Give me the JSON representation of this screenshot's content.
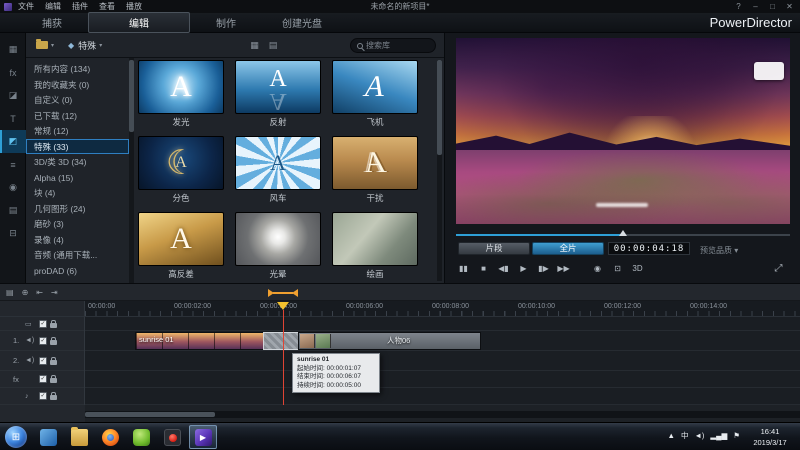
{
  "menubar": {
    "menus": [
      "文件",
      "编辑",
      "插件",
      "查看",
      "播放"
    ],
    "title": "未命名的新项目*",
    "window_controls": {
      "help": "?",
      "minimize": "–",
      "maximize": "□",
      "close": "✕"
    }
  },
  "modebar": {
    "tabs": [
      {
        "id": "capture",
        "label": "捕获",
        "active": false
      },
      {
        "id": "edit",
        "label": "编辑",
        "active": true
      },
      {
        "id": "produce",
        "label": "制作",
        "active": false
      },
      {
        "id": "create-disc",
        "label": "创建光盘",
        "active": false
      }
    ],
    "brand": "PowerDirector"
  },
  "rail": {
    "rooms": [
      {
        "name": "media-room",
        "glyph": "▦",
        "active": false
      },
      {
        "name": "effect-room",
        "glyph": "fx",
        "active": false
      },
      {
        "name": "pip-room",
        "glyph": "◪",
        "active": false
      },
      {
        "name": "title-room",
        "glyph": "T",
        "active": false
      },
      {
        "name": "transition-room",
        "glyph": "◩",
        "active": true
      },
      {
        "name": "audio-mixing-room",
        "glyph": "≡",
        "active": false
      },
      {
        "name": "voice-over-room",
        "glyph": "◉",
        "active": false
      },
      {
        "name": "chapter-room",
        "glyph": "▤",
        "active": false
      },
      {
        "name": "subtitle-room",
        "glyph": "⊟",
        "active": false
      }
    ]
  },
  "library": {
    "toolbar": {
      "filter_icon": "◆",
      "filter_label": "特殊",
      "search_placeholder": "搜索库",
      "view_icons": [
        {
          "name": "grid-view-icon",
          "glyph": "▦"
        },
        {
          "name": "list-view-icon",
          "glyph": "▤"
        }
      ]
    },
    "categories": [
      {
        "label": "所有内容 (134)",
        "selected": false
      },
      {
        "label": "我的收藏夹 (0)",
        "selected": false
      },
      {
        "label": "自定义 (0)",
        "selected": false
      },
      {
        "label": "已下载 (12)",
        "selected": false
      },
      {
        "label": "常规 (12)",
        "selected": false
      },
      {
        "label": "特殊 (33)",
        "selected": true
      },
      {
        "label": "3D/类 3D (34)",
        "selected": false
      },
      {
        "label": "Alpha (15)",
        "selected": false
      },
      {
        "label": "块 (4)",
        "selected": false
      },
      {
        "label": "几何图形 (24)",
        "selected": false
      },
      {
        "label": "磨砂 (3)",
        "selected": false
      },
      {
        "label": "录像 (4)",
        "selected": false
      },
      {
        "label": "音频 (通用下载...",
        "selected": false
      },
      {
        "label": "proDAD (6)",
        "selected": false
      }
    ],
    "transitions": [
      {
        "label": "发光",
        "variant": "glow"
      },
      {
        "label": "反射",
        "variant": "reflect"
      },
      {
        "label": "飞机",
        "variant": "plane"
      },
      {
        "label": "分色",
        "variant": "split"
      },
      {
        "label": "风车",
        "variant": "pinwheel"
      },
      {
        "label": "干扰",
        "variant": "noise"
      },
      {
        "label": "高反差",
        "variant": "contrast"
      },
      {
        "label": "光晕",
        "variant": "halo"
      },
      {
        "label": "绘画",
        "variant": "paint"
      }
    ]
  },
  "preview": {
    "clip_button": "片段",
    "movie_button": "全片",
    "timecode": "00:00:04:18",
    "quality_label": "预览品质 ▾",
    "transport": [
      {
        "name": "pause-button",
        "glyph": "▮▮"
      },
      {
        "name": "stop-button",
        "glyph": "■"
      },
      {
        "name": "step-back-button",
        "glyph": "◀▮"
      },
      {
        "name": "play-button",
        "glyph": "▶"
      },
      {
        "name": "step-forward-button",
        "glyph": "▮▶"
      },
      {
        "name": "fast-forward-button",
        "glyph": "▶▶"
      },
      {
        "name": "snapshot-button",
        "glyph": "◉"
      },
      {
        "name": "preview-window-button",
        "glyph": "⊡"
      },
      {
        "name": "3d-mode-button",
        "glyph": "3D"
      },
      {
        "name": "fullscreen-button",
        "glyph": "⤢"
      }
    ]
  },
  "timeline": {
    "toolbar_icons": [
      {
        "name": "track-manager-icon",
        "glyph": "▤"
      },
      {
        "name": "snap-icon",
        "glyph": "⊕"
      },
      {
        "name": "rail-start-icon",
        "glyph": "⇤"
      },
      {
        "name": "rail-end-icon",
        "glyph": "⇥"
      }
    ],
    "ruler_labels": [
      "00:00:00",
      "00:00:02:00",
      "00:00:04:00",
      "00:00:06:00",
      "00:00:08:00",
      "00:00:10:00",
      "00:00:12:00",
      "00:00:14:00"
    ],
    "tracks": [
      {
        "name": "video-track-top",
        "num": "",
        "icon": "▭",
        "kind": "video"
      },
      {
        "name": "track-1",
        "num": "1.",
        "icon": "◄)",
        "kind": "audio"
      },
      {
        "name": "track-2",
        "num": "2.",
        "icon": "◄)",
        "kind": "audio"
      },
      {
        "name": "effect-track",
        "num": "fx",
        "icon": "",
        "kind": "fx"
      },
      {
        "name": "music-track",
        "num": "",
        "icon": "♪",
        "kind": "music"
      }
    ],
    "clips": [
      {
        "label": "sunrise 01"
      },
      {
        "label": "人物06"
      }
    ],
    "tooltip": {
      "title": "sunrise 01",
      "start": "起始时间: 00:00:01:07",
      "end": "结束时间: 00:00:06:07",
      "duration": "持续时间: 00:00:05:00"
    }
  },
  "taskbar": {
    "start_glyph": "⊞",
    "apps": [
      {
        "name": "photo-viewer",
        "variant": "viewer",
        "active": false
      },
      {
        "name": "file-explorer",
        "variant": "explorer",
        "active": false
      },
      {
        "name": "firefox",
        "variant": "firefox",
        "active": false
      },
      {
        "name": "android-tool",
        "variant": "android",
        "active": false
      },
      {
        "name": "screen-recorder",
        "variant": "recorder",
        "active": false
      },
      {
        "name": "powerdirector",
        "variant": "powerdirector",
        "active": true
      }
    ],
    "tray": [
      {
        "name": "tray-expand",
        "glyph": "▲"
      },
      {
        "name": "ime-indicator",
        "glyph": "中"
      },
      {
        "name": "volume",
        "glyph": "◄)"
      },
      {
        "name": "network",
        "glyph": "▂▄▆"
      },
      {
        "name": "action-center",
        "glyph": "⚑"
      }
    ],
    "clock": {
      "time": "16:41",
      "date": "2019/3/17"
    }
  }
}
